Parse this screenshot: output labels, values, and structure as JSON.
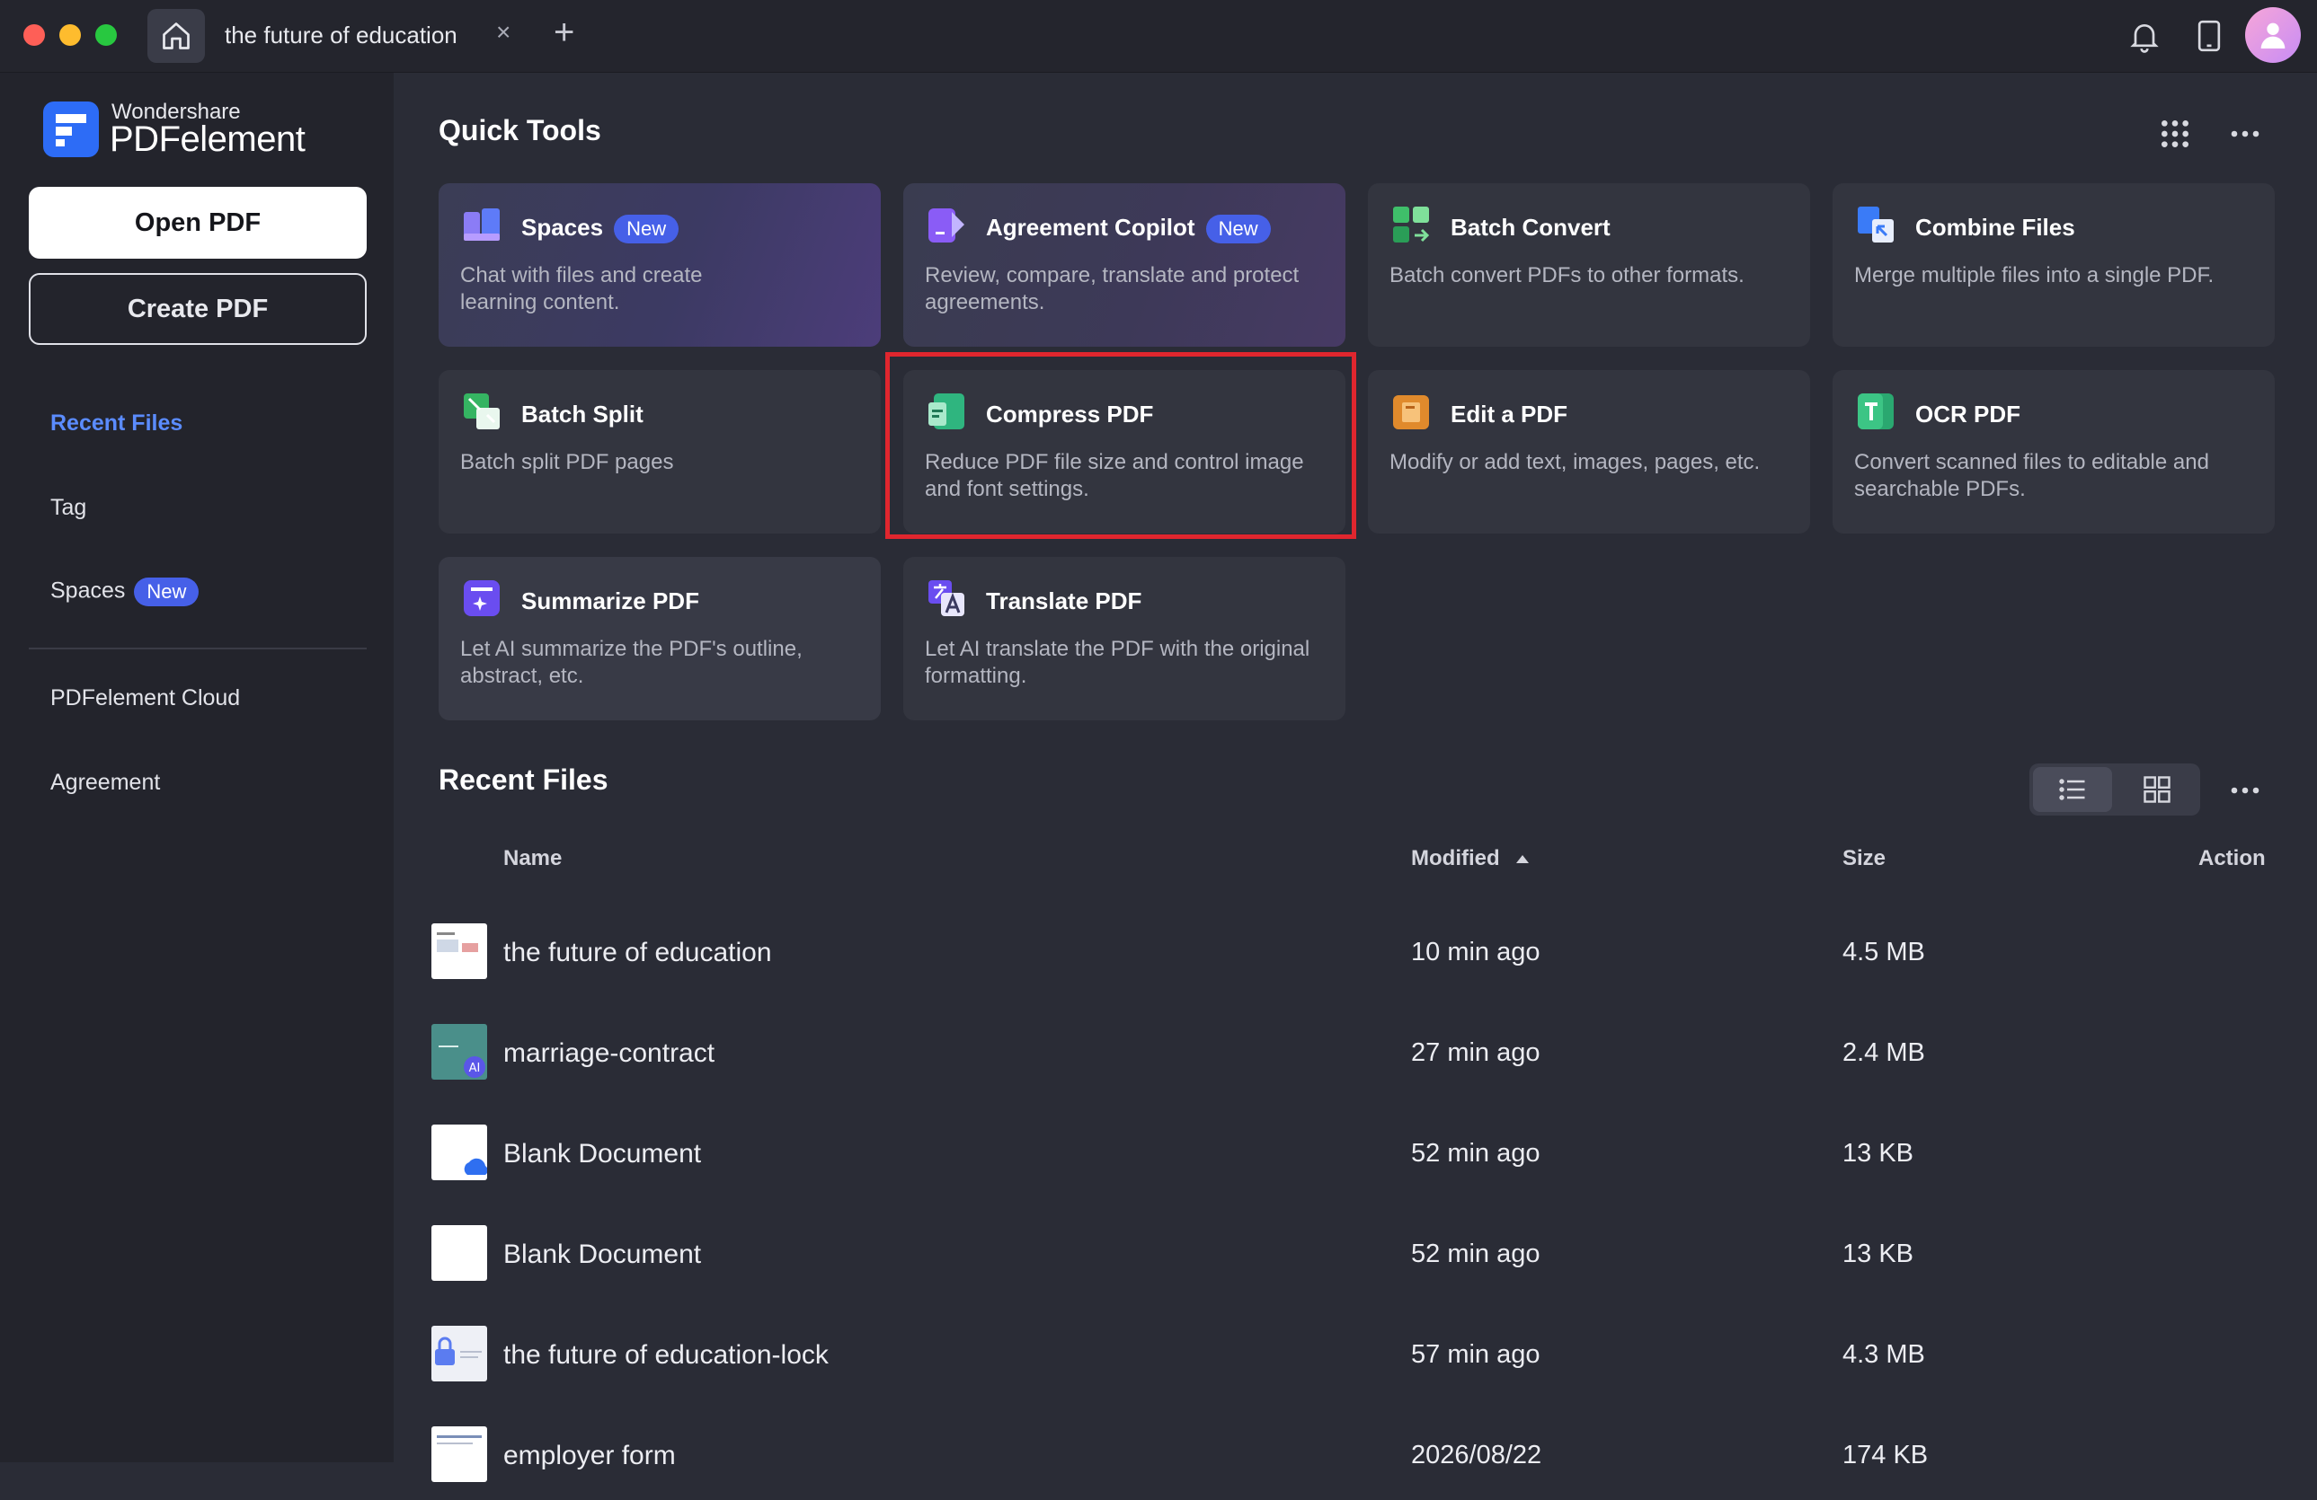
{
  "titlebar": {
    "tab_title": "the future of education",
    "close_glyph": "×",
    "add_glyph": "+",
    "icons": [
      "home-icon",
      "bell-icon",
      "tablet-icon",
      "user-avatar"
    ]
  },
  "sidebar": {
    "brand_small": "Wondershare",
    "brand_big": "PDFelement",
    "open_pdf": "Open PDF",
    "create_pdf": "Create PDF",
    "items": [
      {
        "label": "Recent Files",
        "active": true
      },
      {
        "label": "Tag"
      },
      {
        "label": "Spaces",
        "badge": "New"
      },
      {
        "label": "PDFelement Cloud"
      },
      {
        "label": "Agreement"
      }
    ]
  },
  "quick_tools": {
    "title": "Quick Tools",
    "cards": [
      {
        "title": "Spaces",
        "badge": "New",
        "desc": "Chat with files and create learning content.",
        "icon": "spaces-icon"
      },
      {
        "title": "Agreement Copilot",
        "badge": "New",
        "desc": "Review, compare, translate and protect agreements.",
        "icon": "agreement-copilot-icon"
      },
      {
        "title": "Batch Convert",
        "desc": "Batch convert PDFs to other formats.",
        "icon": "batch-convert-icon"
      },
      {
        "title": "Combine Files",
        "desc": "Merge multiple files into a single PDF.",
        "icon": "combine-files-icon"
      },
      {
        "title": "Batch Split",
        "desc": "Batch split PDF pages",
        "icon": "batch-split-icon"
      },
      {
        "title": "Compress PDF",
        "desc": "Reduce PDF file size and control image and font settings.",
        "icon": "compress-pdf-icon"
      },
      {
        "title": "Edit a PDF",
        "desc": "Modify or add text, images, pages, etc.",
        "icon": "edit-pdf-icon"
      },
      {
        "title": "OCR PDF",
        "desc": "Convert scanned files to editable and searchable PDFs.",
        "icon": "ocr-pdf-icon"
      },
      {
        "title": "Summarize PDF",
        "desc": "Let AI summarize the PDF's outline, abstract, etc.",
        "icon": "summarize-pdf-icon"
      },
      {
        "title": "Translate PDF",
        "desc": "Let AI translate the PDF with the original formatting.",
        "icon": "translate-pdf-icon"
      }
    ]
  },
  "recent_files": {
    "title": "Recent Files",
    "columns": {
      "name": "Name",
      "modified": "Modified",
      "size": "Size",
      "action": "Action"
    },
    "rows": [
      {
        "name": "the future of education",
        "modified": "10 min ago",
        "size": "4.5 MB"
      },
      {
        "name": "marriage-contract",
        "modified": "27 min ago",
        "size": "2.4 MB"
      },
      {
        "name": "Blank Document",
        "modified": "52 min ago",
        "size": "13 KB"
      },
      {
        "name": "Blank Document",
        "modified": "52 min ago",
        "size": "13 KB"
      },
      {
        "name": "the future of education-lock",
        "modified": "57 min ago",
        "size": "4.3 MB"
      },
      {
        "name": "employer form",
        "modified": "2026/08/22",
        "size": "174 KB"
      }
    ]
  },
  "colors": {
    "accent": "#5b8cff",
    "badge": "#4660e8",
    "highlight": "#e0262e",
    "background": "#2a2c36"
  }
}
